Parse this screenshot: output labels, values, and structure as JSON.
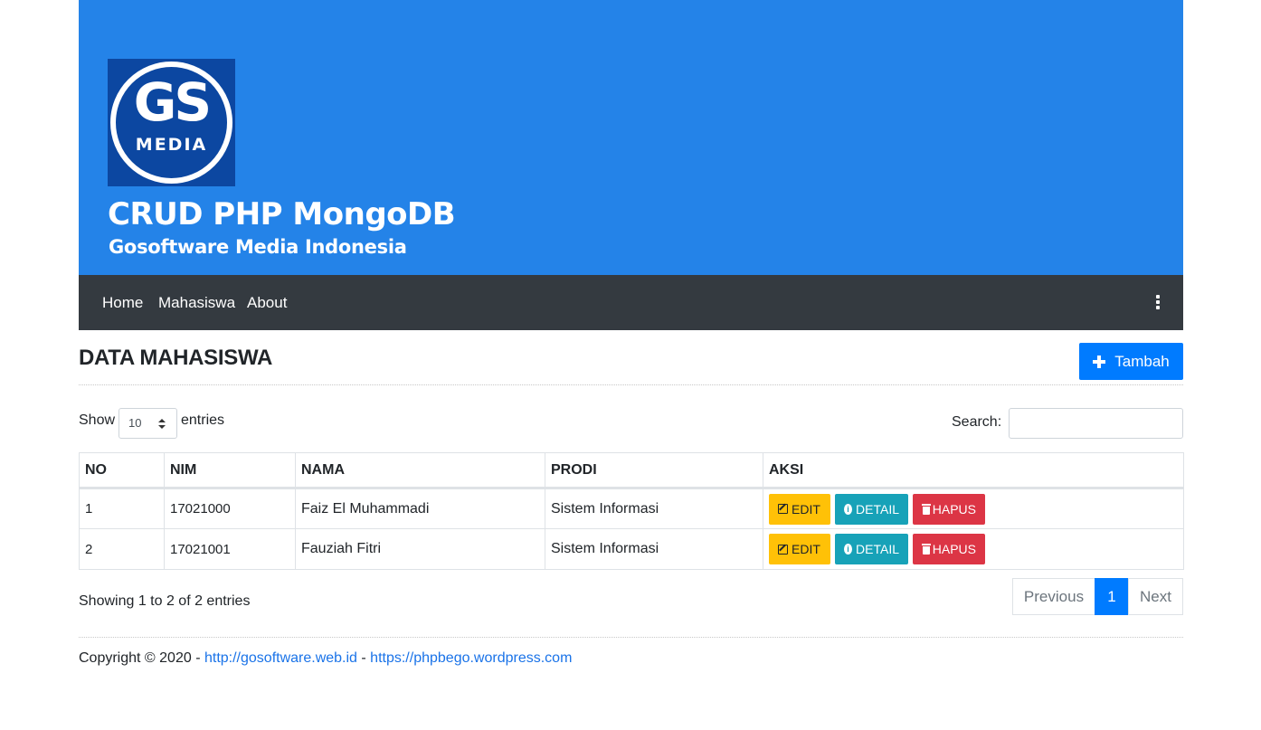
{
  "banner": {
    "logo_text_main": "GS",
    "logo_text_sub": "MEDIA",
    "title": "CRUD PHP MongoDB",
    "subtitle": "Gosoftware Media Indonesia"
  },
  "navbar": {
    "items": [
      {
        "label": "Home"
      },
      {
        "label": "Mahasiswa"
      },
      {
        "label": "About"
      }
    ]
  },
  "page": {
    "title": "DATA MAHASISWA",
    "add_button_label": "Tambah"
  },
  "datatable": {
    "show_label": "Show",
    "page_length": "10",
    "entries_label": "entries",
    "search_label": "Search:",
    "search_value": "",
    "columns": [
      "NO",
      "NIM",
      "NAMA",
      "PRODI",
      "AKSI"
    ],
    "rows": [
      {
        "no": "1",
        "nim": "17021000",
        "nama": "Faiz El Muhammadi",
        "prodi": "Sistem Informasi"
      },
      {
        "no": "2",
        "nim": "17021001",
        "nama": "Fauziah Fitri",
        "prodi": "Sistem Informasi"
      }
    ],
    "actions": {
      "edit": "EDIT",
      "detail": "DETAIL",
      "hapus": "HAPUS"
    },
    "info": "Showing 1 to 2 of 2 entries",
    "pagination": {
      "previous": "Previous",
      "current": "1",
      "next": "Next"
    }
  },
  "footer": {
    "prefix": "Copyright © 2020 - ",
    "link1": "http://gosoftware.web.id",
    "separator": " - ",
    "link2": "https://phpbego.wordpress.com"
  },
  "colors": {
    "banner": "#2483e8",
    "navbar": "#343a40",
    "primary": "#007bff",
    "warning": "#ffc107",
    "info": "#17a2b8",
    "danger": "#dc3545"
  }
}
